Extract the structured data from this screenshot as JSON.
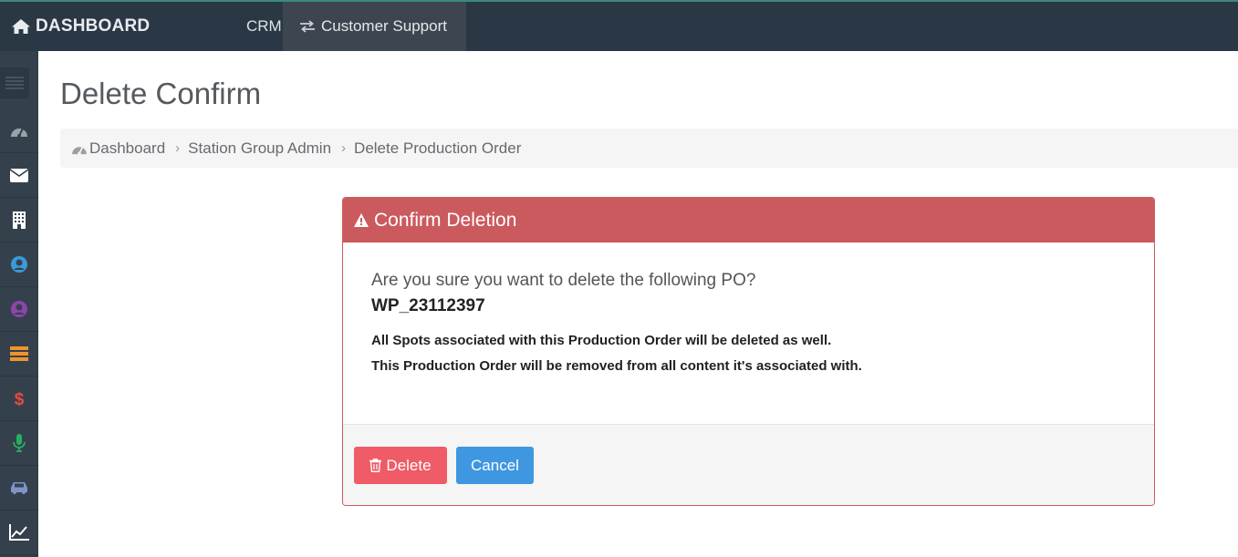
{
  "topbar": {
    "brand": "DASHBOARD",
    "nav": [
      "CRM",
      "Customer Support"
    ]
  },
  "sidebar": {
    "items": [
      {
        "icon": "dashboard-icon",
        "color": "#9aa3ab"
      },
      {
        "icon": "envelope-icon",
        "color": "#ffffff"
      },
      {
        "icon": "building-icon",
        "color": "#ffffff"
      },
      {
        "icon": "user-circle-icon",
        "color": "#3a9ad9"
      },
      {
        "icon": "user-circle-icon",
        "color": "#8e44ad"
      },
      {
        "icon": "server-icon",
        "color": "#f0932b"
      },
      {
        "icon": "dollar-icon",
        "color": "#e74c3c"
      },
      {
        "icon": "microphone-icon",
        "color": "#27ae60"
      },
      {
        "icon": "car-icon",
        "color": "#7f93c9"
      },
      {
        "icon": "line-chart-icon",
        "color": "#ffffff"
      }
    ]
  },
  "page": {
    "title": "Delete Confirm"
  },
  "breadcrumb": [
    "Dashboard",
    "Station Group Admin",
    "Delete Production Order"
  ],
  "dialog": {
    "title": "Confirm Deletion",
    "question": "Are you sure you want to delete the following PO?",
    "po_number": "WP_23112397",
    "note1": "All Spots associated with this Production Order will be deleted as well.",
    "note2": "This Production Order will be removed from all content it's associated with.",
    "delete_label": "Delete",
    "cancel_label": "Cancel"
  },
  "colors": {
    "danger": "#cb5a5e",
    "delete_button": "#ef5b67",
    "cancel_button": "#3e97e0",
    "navbar": "#2a3744",
    "sidebar": "#34414d"
  }
}
